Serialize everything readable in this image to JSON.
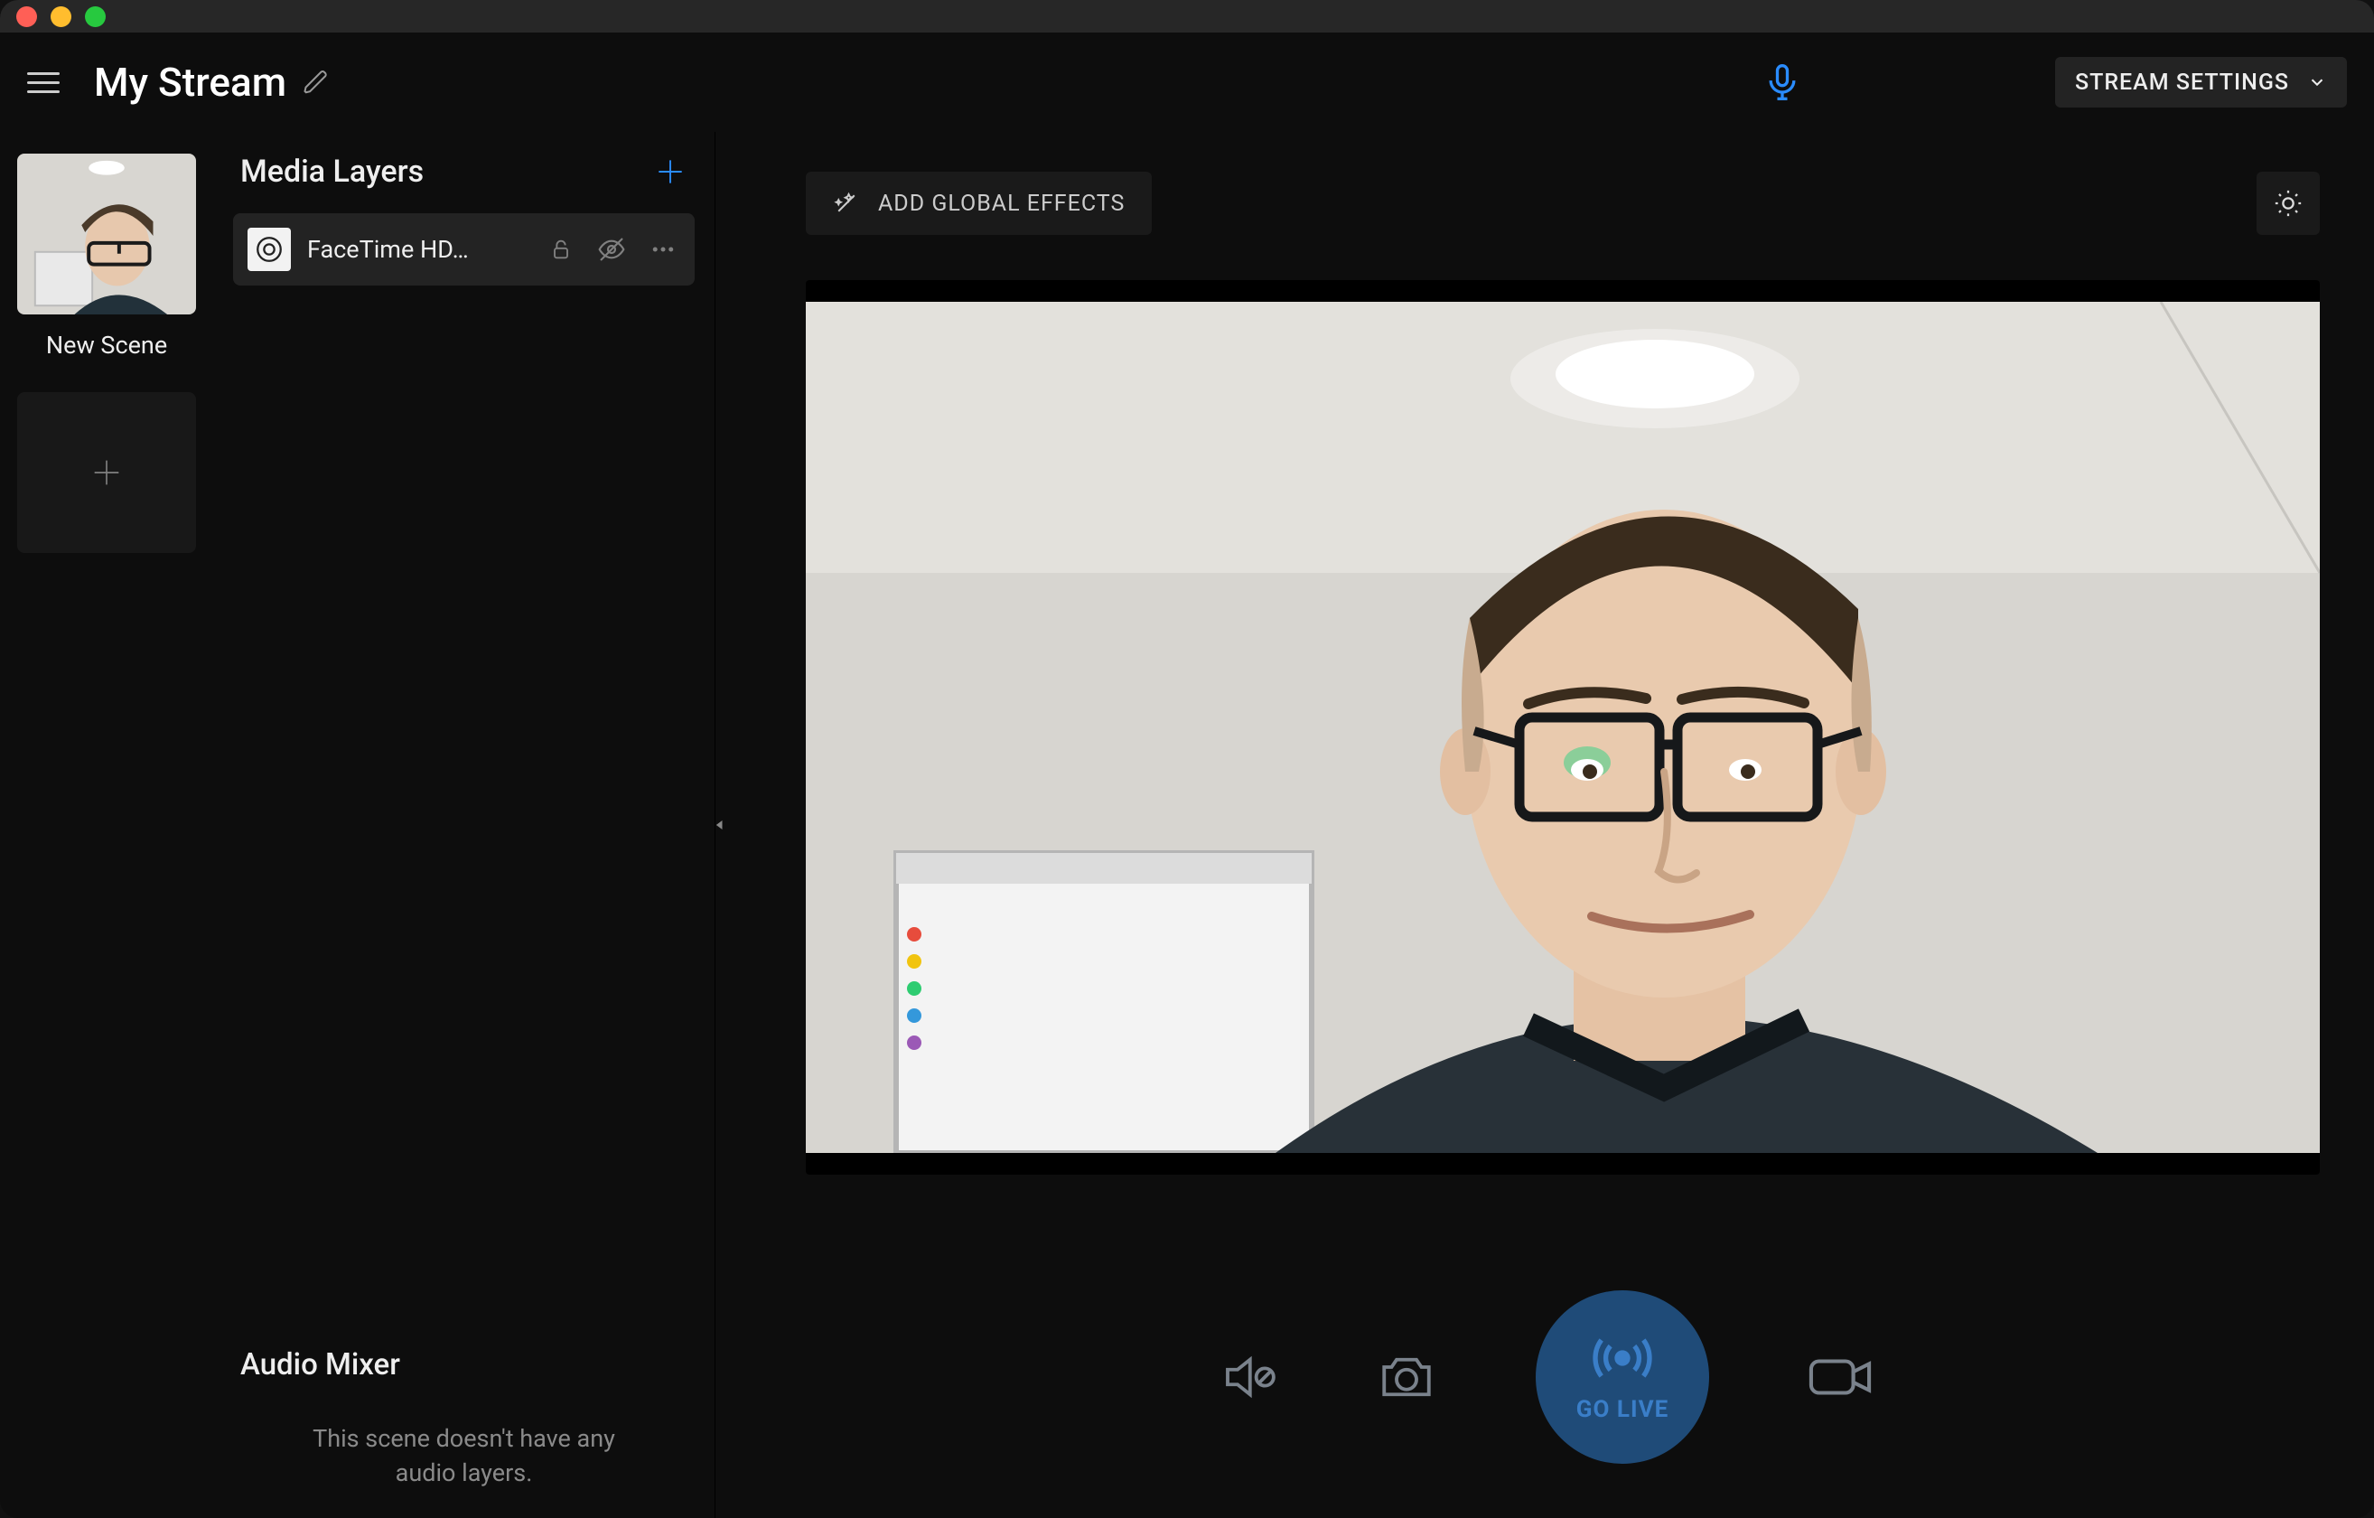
{
  "header": {
    "title": "My Stream",
    "settings_label": "STREAM SETTINGS"
  },
  "scenes": [
    {
      "name": "New Scene"
    }
  ],
  "layers_panel": {
    "title": "Media Layers",
    "items": [
      {
        "name": "FaceTime HD…"
      }
    ]
  },
  "audio_mixer": {
    "title": "Audio Mixer",
    "empty_line1": "This scene doesn't have any",
    "empty_line2": "audio layers."
  },
  "preview": {
    "effects_label": "ADD GLOBAL EFFECTS"
  },
  "controls": {
    "go_live_label": "GO LIVE"
  }
}
